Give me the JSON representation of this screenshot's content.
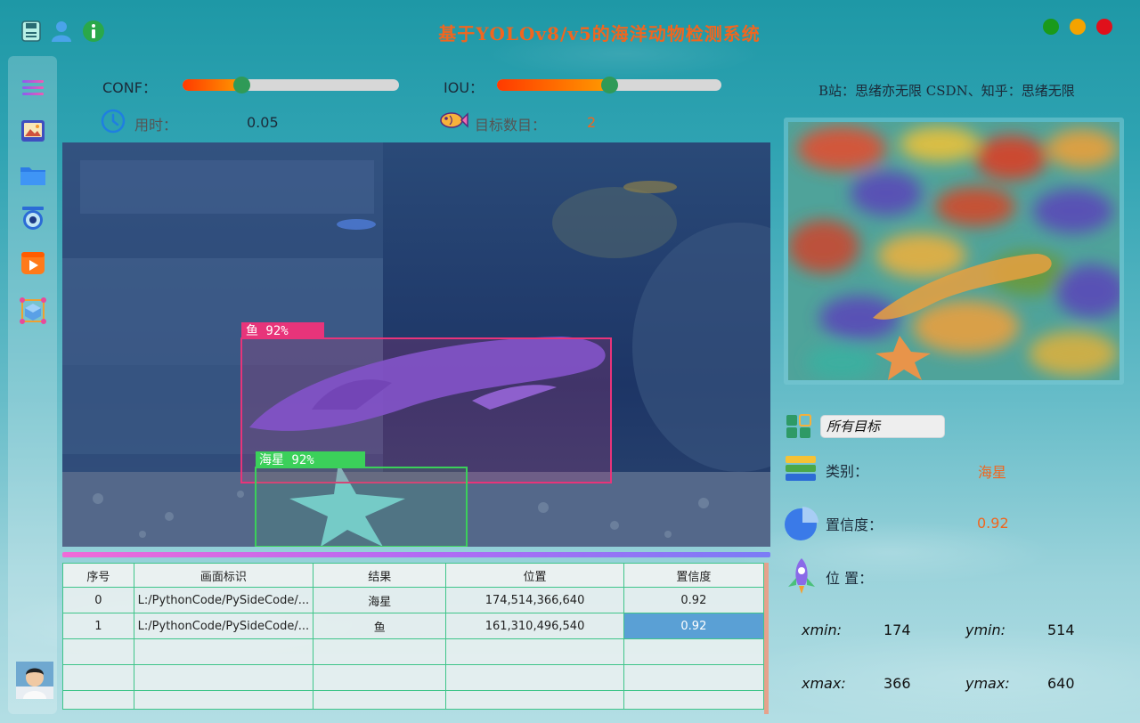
{
  "window": {
    "title": "基于YOLOv8/v5的海洋动物检测系统",
    "controls": {
      "close_color": "#e0101b",
      "minimize_color": "#f5a300",
      "maximize_color": "#1a9a1a"
    }
  },
  "toolbar": {
    "icons": [
      "save-icon",
      "user-icon",
      "info-icon"
    ]
  },
  "sidebar": {
    "items": [
      "menu-icon",
      "image-icon",
      "folder-icon",
      "camera-icon",
      "video-icon",
      "model-icon"
    ]
  },
  "params": {
    "conf_label": "CONF：",
    "conf_value": 0.25,
    "iou_label": "IOU：",
    "iou_value": 0.5,
    "time_label": "用时：",
    "time_value": "0.05",
    "count_label": "目标数目：",
    "count_value": "2"
  },
  "credits": "B站：思绪亦无限  CSDN、知乎：思绪无限",
  "detections": [
    {
      "label": "鱼 92%",
      "color": "#e8347a"
    },
    {
      "label": "海星 92%",
      "color": "#3bd05a"
    }
  ],
  "table": {
    "headers": [
      "序号",
      "画面标识",
      "结果",
      "位置",
      "置信度"
    ],
    "rows": [
      [
        "0",
        "L:/PythonCode/PySideCode/...",
        "海星",
        "174,514,366,640",
        "0.92"
      ],
      [
        "1",
        "L:/PythonCode/PySideCode/...",
        "鱼",
        "161,310,496,540",
        "0.92"
      ],
      [
        "",
        "",
        "",
        "",
        ""
      ],
      [
        "",
        "",
        "",
        "",
        ""
      ],
      [
        "",
        "",
        "",
        "",
        ""
      ]
    ]
  },
  "result": {
    "target_select": "所有目标",
    "class_label": "类别：",
    "class_value": "海星",
    "conf_label": "置信度：",
    "conf_value": "0.92",
    "pos_label": "位 置：",
    "xmin_label": "xmin:",
    "xmin": "174",
    "ymin_label": "ymin:",
    "ymin": "514",
    "xmax_label": "xmax:",
    "xmax": "366",
    "ymax_label": "ymax:",
    "ymax": "640"
  }
}
